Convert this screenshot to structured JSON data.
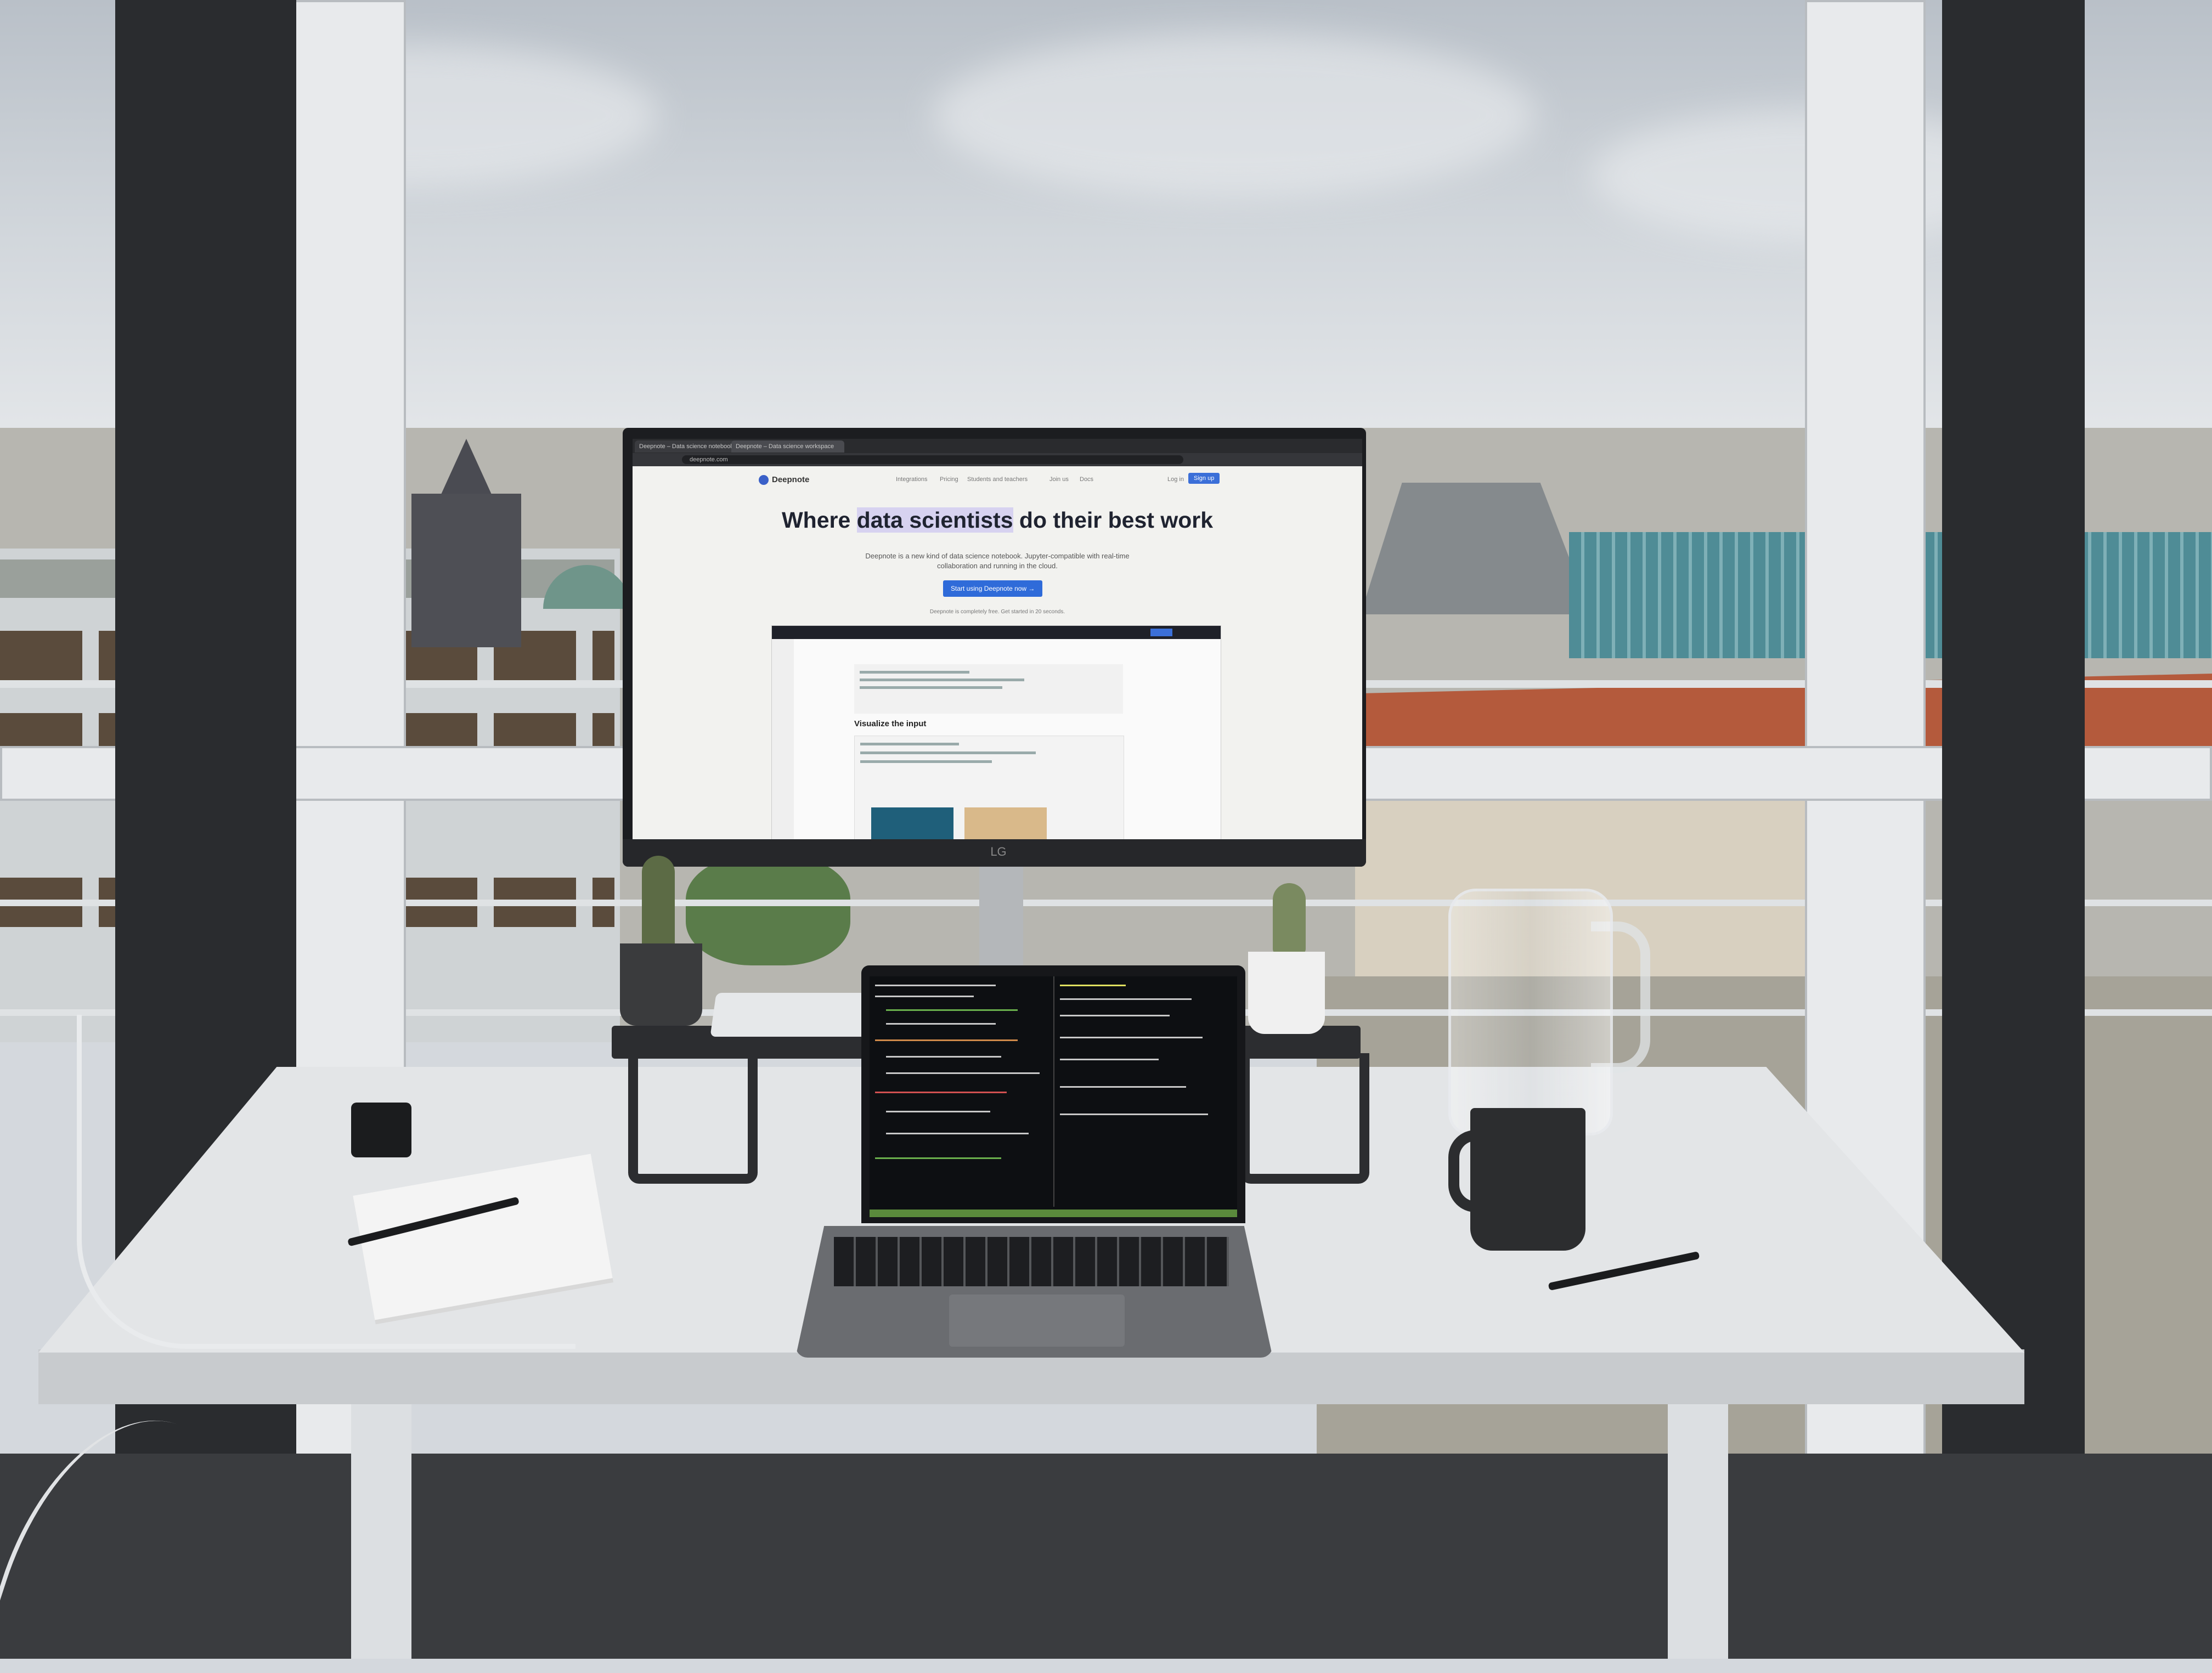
{
  "browser": {
    "tabs": [
      "Deepnote – Data science notebook",
      "Deepnote – Data science workspace"
    ],
    "url": "deepnote.com"
  },
  "site": {
    "logo": "Deepnote",
    "nav": [
      "Integrations",
      "Pricing",
      "Students and teachers",
      "Join us",
      "Docs"
    ],
    "login": "Log in",
    "signup": "Sign up",
    "hero_pre": "Where ",
    "hero_highlight": "data scientists",
    "hero_post": " do their best work",
    "subtitle": "Deepnote is a new kind of data science notebook. Jupyter-compatible with real-time collaboration and running in the cloud.",
    "cta": "Start using Deepnote now →",
    "free_note": "Deepnote is completely free. Get started in 20 seconds.",
    "app_section_title": "Visualize the input"
  },
  "monitor_brand": "LG"
}
